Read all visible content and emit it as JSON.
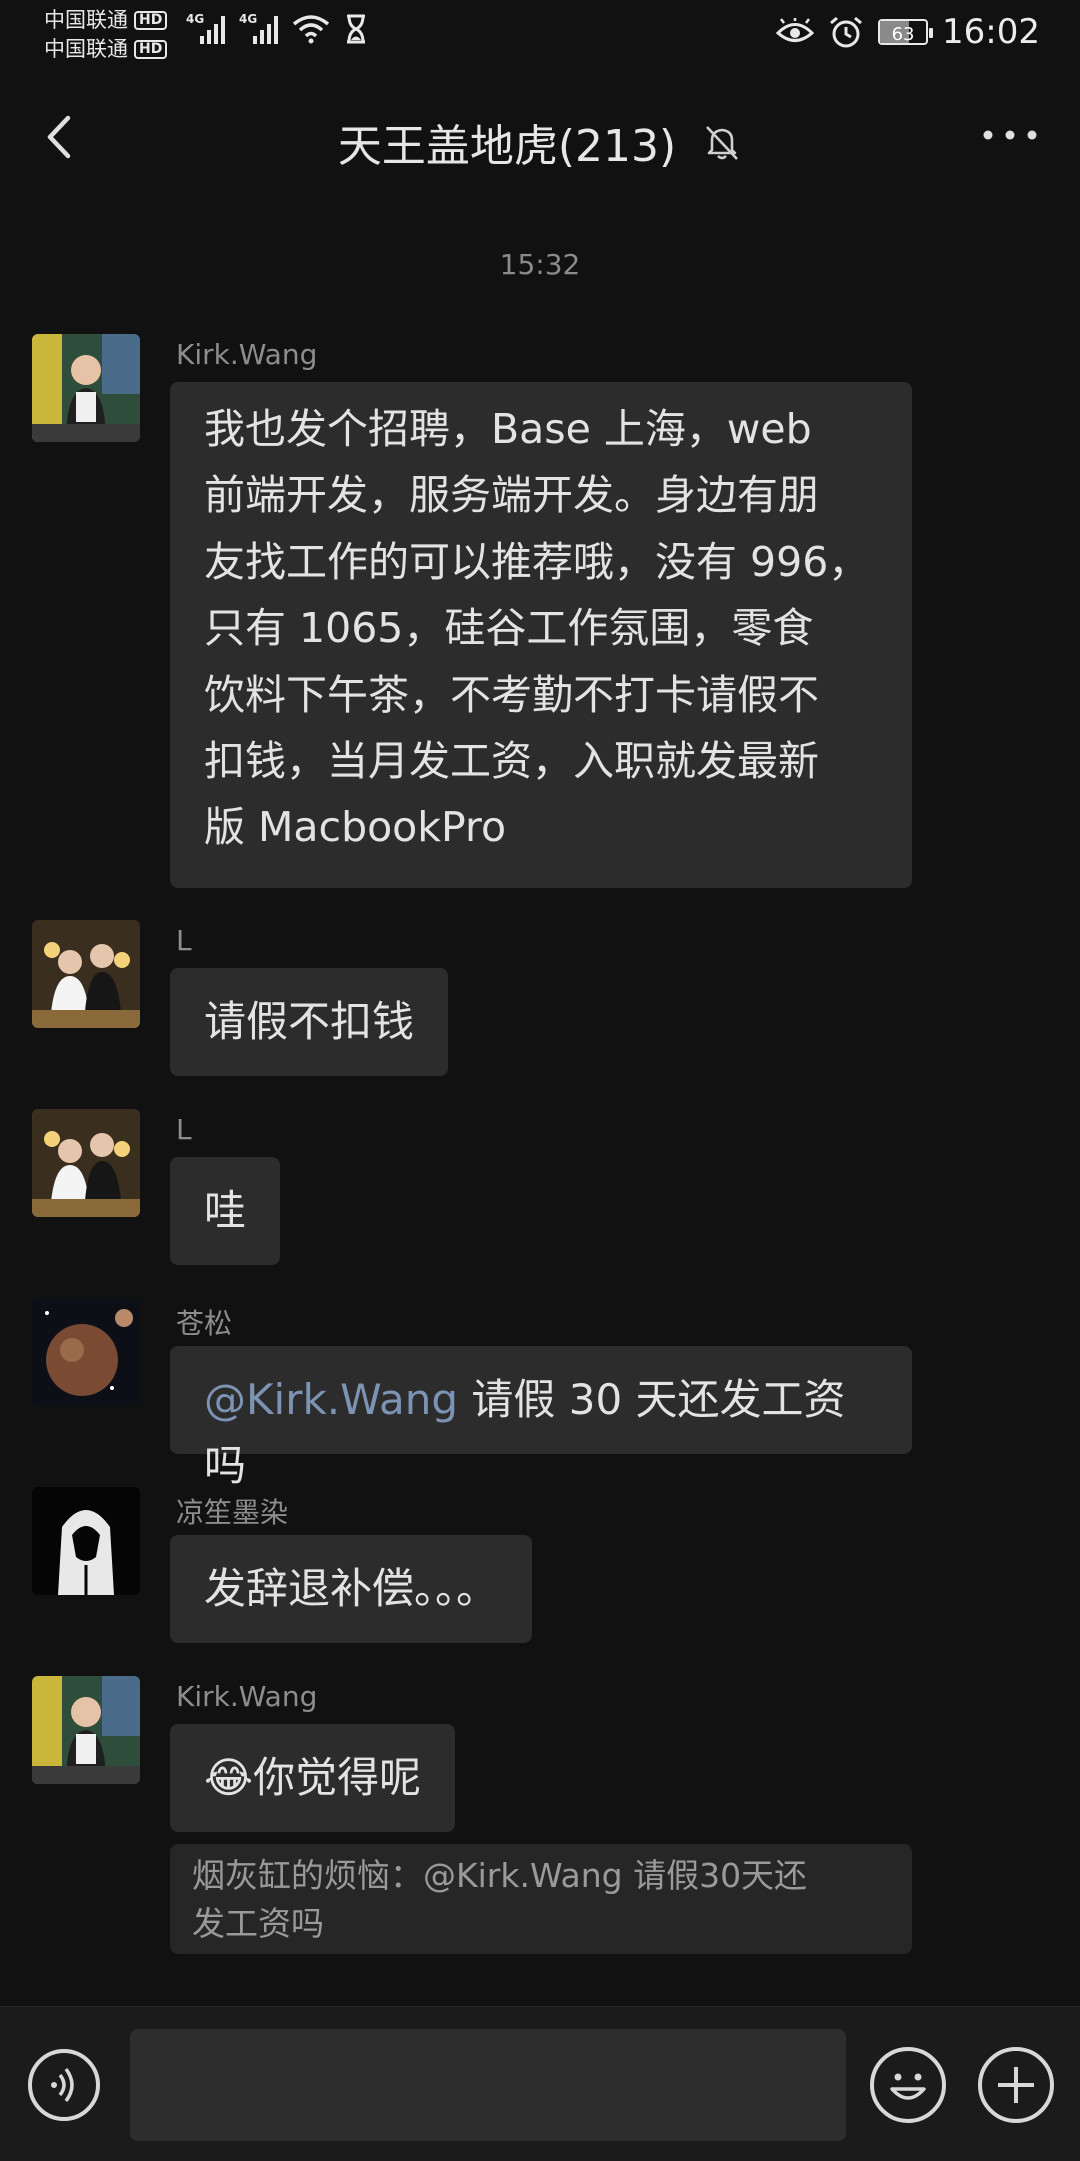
{
  "status_bar": {
    "carrier_1": "中国联通",
    "carrier_2": "中国联通",
    "hd_label": "HD",
    "network_1": "4G",
    "network_2": "4G",
    "battery": "63",
    "battery_level": 0.63,
    "time": "16:02",
    "icons": [
      "eye-icon",
      "alarm-icon",
      "hourglass-icon",
      "wifi-icon"
    ]
  },
  "header": {
    "title": "天王盖地虎(213)",
    "icons": [
      "back-arrow-icon",
      "mute-bell-icon",
      "more-dots-icon"
    ]
  },
  "chat": {
    "time_separator": "15:32",
    "messages": [
      {
        "sender": "Kirk.Wang",
        "lines": [
          "我也发个招聘，Base 上海，web",
          "前端开发，服务端开发。身边有朋",
          "友找工作的可以推荐哦，没有 996，",
          "只有 1065，硅谷工作氛围，零食",
          "饮料下午茶，不考勤不打卡请假不",
          "扣钱，当月发工资，入职就发最新",
          "版 MacbookPro"
        ]
      },
      {
        "sender": "L",
        "text": "请假不扣钱"
      },
      {
        "sender": "L",
        "text": "哇"
      },
      {
        "sender": "苍松",
        "mention": "@Kirk.Wang",
        "text": " 请假 30 天还发工资吗"
      },
      {
        "sender": "凉笙墨染",
        "text": "发辞退补偿。。。"
      },
      {
        "sender": "Kirk.Wang",
        "emoji": "😂",
        "text": "你觉得呢",
        "quote_line1": "烟灰缸的烦恼：@Kirk.Wang 请假30天还",
        "quote_line2": "发工资吗"
      }
    ]
  },
  "input_bar": {
    "icons": [
      "voice-icon",
      "emoji-icon",
      "plus-icon"
    ],
    "input_value": ""
  }
}
